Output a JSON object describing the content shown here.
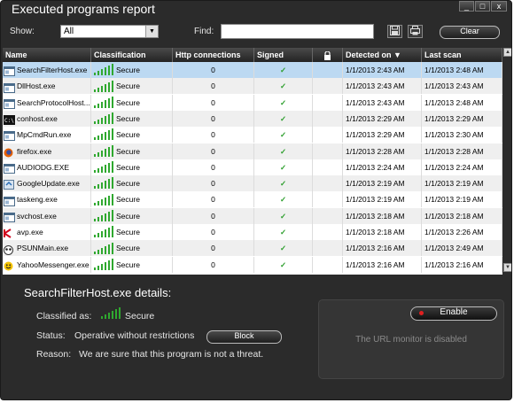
{
  "window": {
    "title": "Executed programs report",
    "controls": {
      "minimize": "_",
      "maximize": "□",
      "close": "x"
    }
  },
  "toolbar": {
    "show_label": "Show:",
    "show_value": "All",
    "find_label": "Find:",
    "find_value": "",
    "save_icon": "save-icon",
    "print_icon": "print-icon",
    "clear_label": "Clear"
  },
  "table": {
    "headers": [
      "Name",
      "Classification",
      "Http connections",
      "Signed",
      "",
      "Detected on",
      "Last scan"
    ],
    "sort_indicator": "▼",
    "rows": [
      {
        "name": "SearchFilterHost.exe",
        "icon": "window-icon",
        "classification": "Secure",
        "http": "0",
        "signed": "✓",
        "detected": "1/1/2013 2:43 AM",
        "last_scan": "1/1/2013 2:48 AM"
      },
      {
        "name": "DllHost.exe",
        "icon": "window-icon",
        "classification": "Secure",
        "http": "0",
        "signed": "✓",
        "detected": "1/1/2013 2:43 AM",
        "last_scan": "1/1/2013 2:43 AM"
      },
      {
        "name": "SearchProtocolHost...",
        "icon": "window-icon",
        "classification": "Secure",
        "http": "0",
        "signed": "✓",
        "detected": "1/1/2013 2:43 AM",
        "last_scan": "1/1/2013 2:48 AM"
      },
      {
        "name": "conhost.exe",
        "icon": "console-icon",
        "classification": "Secure",
        "http": "0",
        "signed": "✓",
        "detected": "1/1/2013 2:29 AM",
        "last_scan": "1/1/2013 2:29 AM"
      },
      {
        "name": "MpCmdRun.exe",
        "icon": "window-icon",
        "classification": "Secure",
        "http": "0",
        "signed": "✓",
        "detected": "1/1/2013 2:29 AM",
        "last_scan": "1/1/2013 2:30 AM"
      },
      {
        "name": "firefox.exe",
        "icon": "firefox-icon",
        "classification": "Secure",
        "http": "0",
        "signed": "✓",
        "detected": "1/1/2013 2:28 AM",
        "last_scan": "1/1/2013 2:28 AM"
      },
      {
        "name": "AUDIODG.EXE",
        "icon": "window-icon",
        "classification": "Secure",
        "http": "0",
        "signed": "✓",
        "detected": "1/1/2013 2:24 AM",
        "last_scan": "1/1/2013 2:24 AM"
      },
      {
        "name": "GoogleUpdate.exe",
        "icon": "google-update-icon",
        "classification": "Secure",
        "http": "0",
        "signed": "✓",
        "detected": "1/1/2013 2:19 AM",
        "last_scan": "1/1/2013 2:19 AM"
      },
      {
        "name": "taskeng.exe",
        "icon": "window-icon",
        "classification": "Secure",
        "http": "0",
        "signed": "✓",
        "detected": "1/1/2013 2:19 AM",
        "last_scan": "1/1/2013 2:19 AM"
      },
      {
        "name": "svchost.exe",
        "icon": "window-icon",
        "classification": "Secure",
        "http": "0",
        "signed": "✓",
        "detected": "1/1/2013 2:18 AM",
        "last_scan": "1/1/2013 2:18 AM"
      },
      {
        "name": "avp.exe",
        "icon": "kaspersky-icon",
        "classification": "Secure",
        "http": "0",
        "signed": "✓",
        "detected": "1/1/2013 2:18 AM",
        "last_scan": "1/1/2013 2:26 AM"
      },
      {
        "name": "PSUNMain.exe",
        "icon": "panda-icon",
        "classification": "Secure",
        "http": "0",
        "signed": "✓",
        "detected": "1/1/2013 2:16 AM",
        "last_scan": "1/1/2013 2:49 AM"
      },
      {
        "name": "YahooMessenger.exe",
        "icon": "yahoo-icon",
        "classification": "Secure",
        "http": "0",
        "signed": "✓",
        "detected": "1/1/2013 2:16 AM",
        "last_scan": "1/1/2013 2:16 AM"
      }
    ]
  },
  "details": {
    "title": "SearchFilterHost.exe details:",
    "classified_label": "Classified as:",
    "classified_value": "Secure",
    "status_label": "Status:",
    "status_value": "Operative without restrictions",
    "block_label": "Block",
    "reason_label": "Reason:",
    "reason_value": "We are sure that this program is not a threat."
  },
  "url_monitor": {
    "enable_label": "Enable",
    "status_text": "The URL monitor is disabled"
  },
  "colors": {
    "window_bg": "#2b2b2b",
    "secure_green": "#2fa82f",
    "selected_row": "#bcd9f2",
    "enable_dot": "#e02020"
  }
}
